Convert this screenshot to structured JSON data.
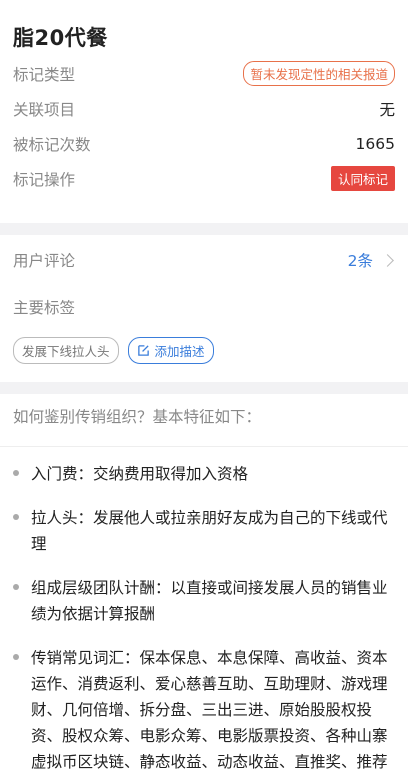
{
  "header": {
    "title": "脂20代餐",
    "rows": [
      {
        "label": "标记类型",
        "value": "暂未发现定性的相关报道"
      },
      {
        "label": "关联项目",
        "value": "无"
      },
      {
        "label": "被标记次数",
        "value": "1665"
      },
      {
        "label": "标记操作",
        "value": "认同标记"
      }
    ]
  },
  "comments": {
    "label": "用户评论",
    "count": "2条",
    "tags_label": "主要标签",
    "tags": [
      "发展下线拉人头"
    ],
    "add_desc": "添加描述"
  },
  "info": {
    "question": "如何鉴别传销组织？基本特征如下：",
    "bullets": [
      "入门费：交纳费用取得加入资格",
      "拉人头：发展他人或拉亲朋好友成为自己的下线或代理",
      "组成层级团队计酬：以直接或间接发展人员的销售业绩为依据计算报酬",
      "传销常见词汇：保本保息、本息保障、高收益、资本运作、消费返利、爱心慈善互助、互助理财、游戏理财、几何倍增、拆分盘、三出三进、原始股股权投资、股权众筹、电影众筹、电影版票投资、各种山寨虚拟币区块链、静态收益、动态收益、直推奖、推荐奖、对碰奖、领导奖等"
    ]
  },
  "colors": {
    "accent_blue": "#3a7ddb",
    "accent_orange": "#e8714a",
    "accent_red": "#e6473f"
  }
}
